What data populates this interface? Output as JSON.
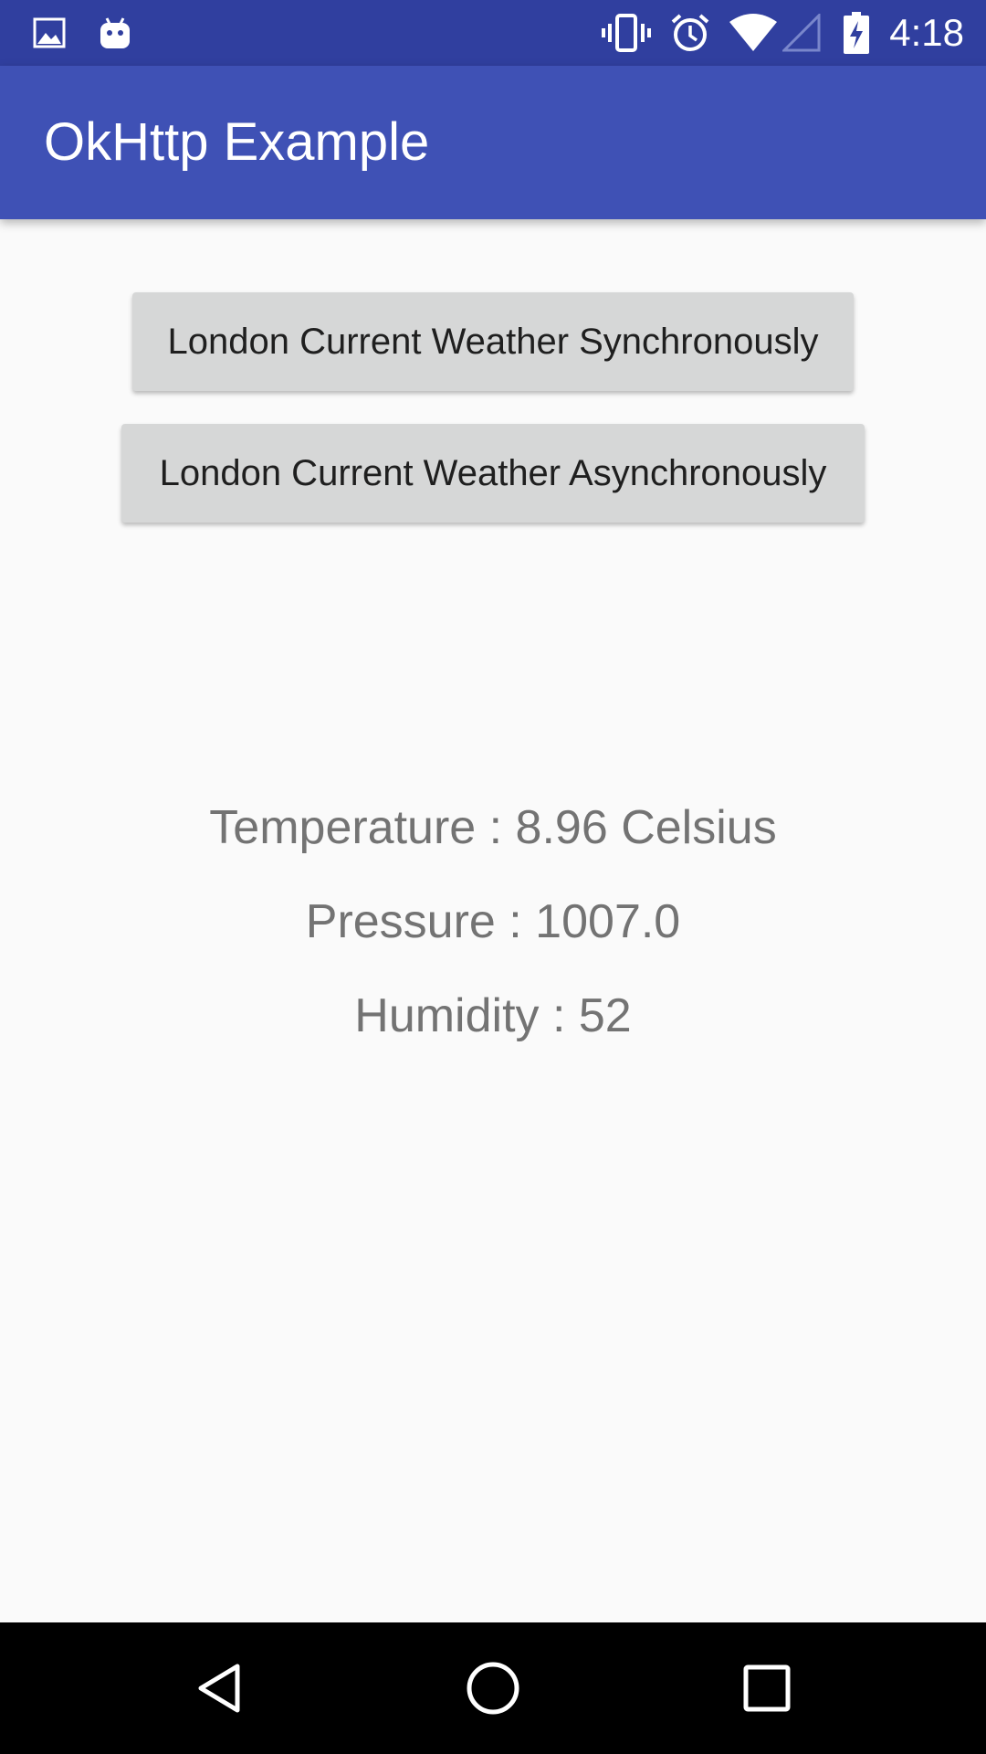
{
  "status_bar": {
    "time": "4:18",
    "icons": [
      "image-icon",
      "android-icon",
      "vibrate-icon",
      "alarm-icon",
      "wifi-icon",
      "signal-icon",
      "battery-charging-icon"
    ],
    "background": "#303f9f"
  },
  "app_bar": {
    "title": "OkHttp Example",
    "background": "#3f51b5"
  },
  "buttons": {
    "sync_label": "London Current Weather Synchronously",
    "async_label": "London Current Weather Asynchronously"
  },
  "weather": {
    "temperature": "Temperature : 8.96 Celsius",
    "pressure": "Pressure : 1007.0",
    "humidity": "Humidity : 52"
  },
  "nav_bar": {
    "icons": [
      "back-icon",
      "home-icon",
      "recents-icon"
    ]
  }
}
